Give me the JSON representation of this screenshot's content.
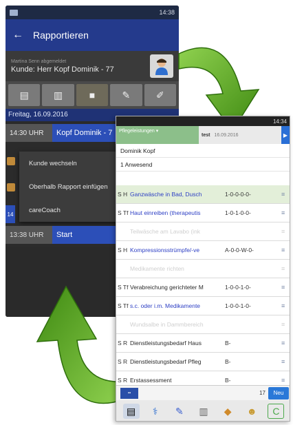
{
  "phone1": {
    "appbar": {
      "back_icon": "back-arrow-icon",
      "title": "Rapportieren"
    },
    "customer": {
      "subtitle": "Martina Senn abgemeldet",
      "label": "Kunde: Herr Kopf Dominik - 77"
    },
    "date": "Freitag, 16.09.2016",
    "row1": {
      "time": "14:30 UHR",
      "name": "Kopf Dominik - 7"
    },
    "context_menu": [
      "Kunde wechseln",
      "Oberhalb Rapport einfügen",
      "careCoach"
    ],
    "side_tag": "14",
    "row2": {
      "time": "13:38 UHR",
      "label": "Start"
    },
    "status_time": "14:38"
  },
  "phone2": {
    "status_time": "14:34",
    "dropdown_label": "Pflegeleistungen ▾",
    "top_title": "test",
    "top_date": "16.09.2016",
    "patient": "Dominik Kopf",
    "present": "1 Anwesend",
    "rows": [
      {
        "code": "S H",
        "name": "Ganzwäsche in Bad, Dusch",
        "pat": "1-0-0-0-0-",
        "style": "sel",
        "color": "blue"
      },
      {
        "code": "S Tf",
        "name": "Haut einreiben (therapeutis",
        "pat": "1-0-1-0-0-",
        "style": "",
        "color": "blue"
      },
      {
        "code": "",
        "name": "Teilwäsche am Lavabo (ink",
        "pat": "",
        "style": "faded",
        "color": ""
      },
      {
        "code": "S H",
        "name": "Kompressionsstrümpfe/-ve",
        "pat": "A-0-0-W-0-",
        "style": "",
        "color": "blue"
      },
      {
        "code": "",
        "name": "Medikamente richten",
        "pat": "",
        "style": "faded",
        "color": ""
      },
      {
        "code": "S Tf",
        "name": "Verabreichung gerichteter M",
        "pat": "1-0-0-1-0-",
        "style": "",
        "color": "dark"
      },
      {
        "code": "S Tf",
        "name": "s.c. oder i.m. Medikamente",
        "pat": "1-0-0-1-0-",
        "style": "",
        "color": "blue"
      },
      {
        "code": "",
        "name": "Wundsalbe in Dammbereich",
        "pat": "",
        "style": "faded",
        "color": ""
      },
      {
        "code": "S R",
        "name": "Dienstleistungsbedarf Haus",
        "pat": "B-",
        "style": "",
        "color": "dark"
      },
      {
        "code": "S R",
        "name": "Dienstleistungsbedarf Pfleg",
        "pat": "B-",
        "style": "",
        "color": "dark"
      },
      {
        "code": "S R",
        "name": "Erstassessment",
        "pat": "B-",
        "style": "",
        "color": "dark"
      }
    ],
    "count": "17",
    "new_button": "Neu",
    "bottom_icons": [
      "documents-icon",
      "stethoscope-icon",
      "syringe-icon",
      "printer-icon",
      "pills-icon",
      "people-icon",
      "carecoach-icon"
    ]
  },
  "colors": {
    "arrow_green": "#5fae1f",
    "app_blue": "#243a8c"
  }
}
